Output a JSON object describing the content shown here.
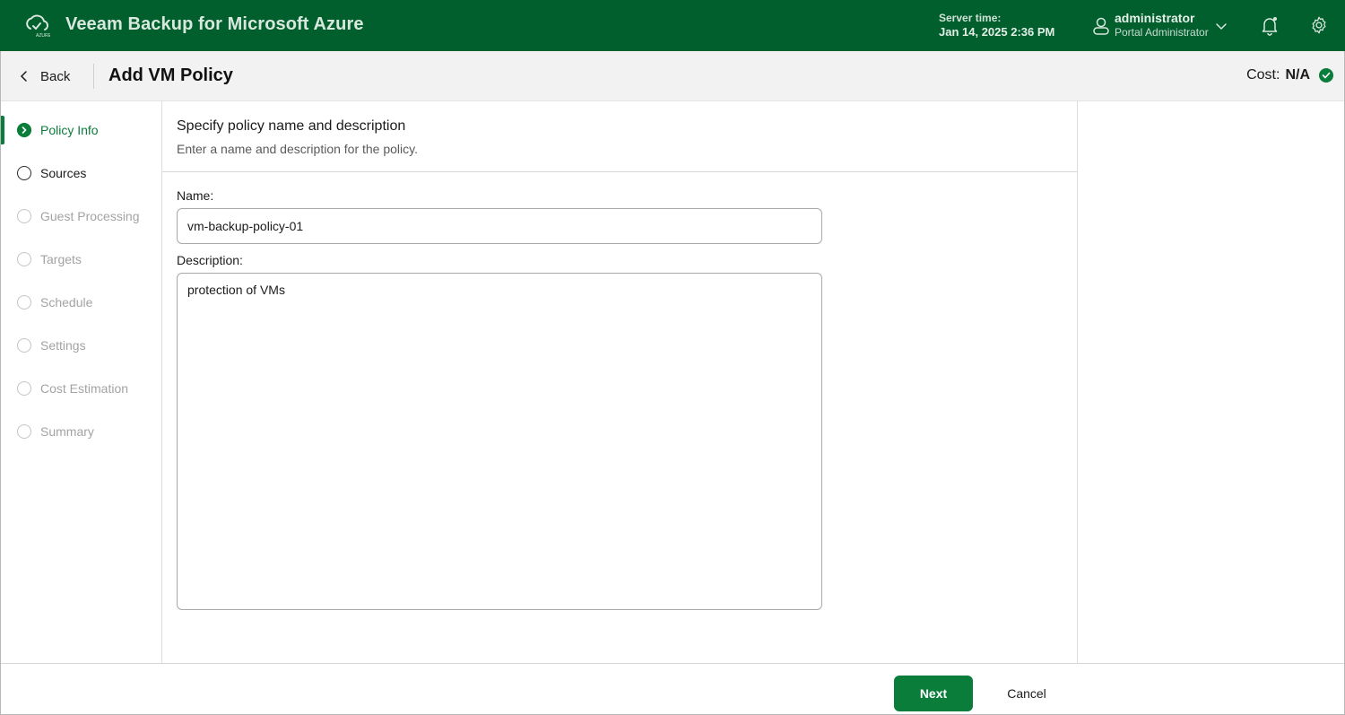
{
  "header": {
    "app_title": "Veeam Backup for Microsoft Azure",
    "logo_icon": "veeam-azure-cloud-icon",
    "server_time_label": "Server time:",
    "server_time_value": "Jan 14, 2025 2:36 PM",
    "user_name": "administrator",
    "user_role": "Portal Administrator",
    "brand_color": "#005f2d"
  },
  "subheader": {
    "back_label": "Back",
    "page_title": "Add VM Policy",
    "cost_label": "Cost:",
    "cost_value": "N/A"
  },
  "steps": [
    {
      "label": "Policy Info",
      "state": "active"
    },
    {
      "label": "Sources",
      "state": "next"
    },
    {
      "label": "Guest Processing",
      "state": "disabled"
    },
    {
      "label": "Targets",
      "state": "disabled"
    },
    {
      "label": "Schedule",
      "state": "disabled"
    },
    {
      "label": "Settings",
      "state": "disabled"
    },
    {
      "label": "Cost Estimation",
      "state": "disabled"
    },
    {
      "label": "Summary",
      "state": "disabled"
    }
  ],
  "form": {
    "title": "Specify policy name and description",
    "description": "Enter a name and description for the policy.",
    "name_label": "Name:",
    "name_value": "vm-backup-policy-01",
    "description_label": "Description:",
    "description_value": "protection of VMs"
  },
  "footer": {
    "next_label": "Next",
    "cancel_label": "Cancel"
  },
  "colors": {
    "accent": "#0a7d3b"
  }
}
